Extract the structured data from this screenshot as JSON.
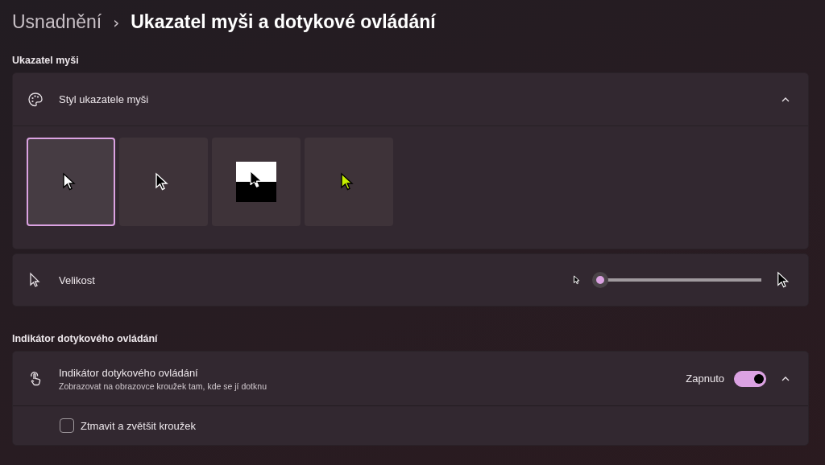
{
  "breadcrumb": {
    "parent": "Usnadnění",
    "separator": "›",
    "title": "Ukazatel myši a dotykové ovládání"
  },
  "sections": [
    {
      "heading": "Ukazatel myši",
      "style_card": {
        "label": "Styl ukazatele myši",
        "expanded": true,
        "styles": [
          {
            "kind": "white",
            "selected": true
          },
          {
            "kind": "black",
            "selected": false
          },
          {
            "kind": "inverted",
            "selected": false
          },
          {
            "kind": "custom",
            "selected": false,
            "color": "#c6f000"
          }
        ]
      },
      "size_card": {
        "label": "Velikost",
        "level": 0
      }
    },
    {
      "heading": "Indikátor dotykového ovládání",
      "touch_card": {
        "label": "Indikátor dotykového ovládání",
        "description": "Zobrazovat na obrazovce kroužek tam, kde se jí dotknu",
        "state_text": "Zapnuto",
        "on": true,
        "expanded": true,
        "option": {
          "label": "Ztmavit a zvětšit kroužek",
          "checked": false
        }
      }
    }
  ]
}
